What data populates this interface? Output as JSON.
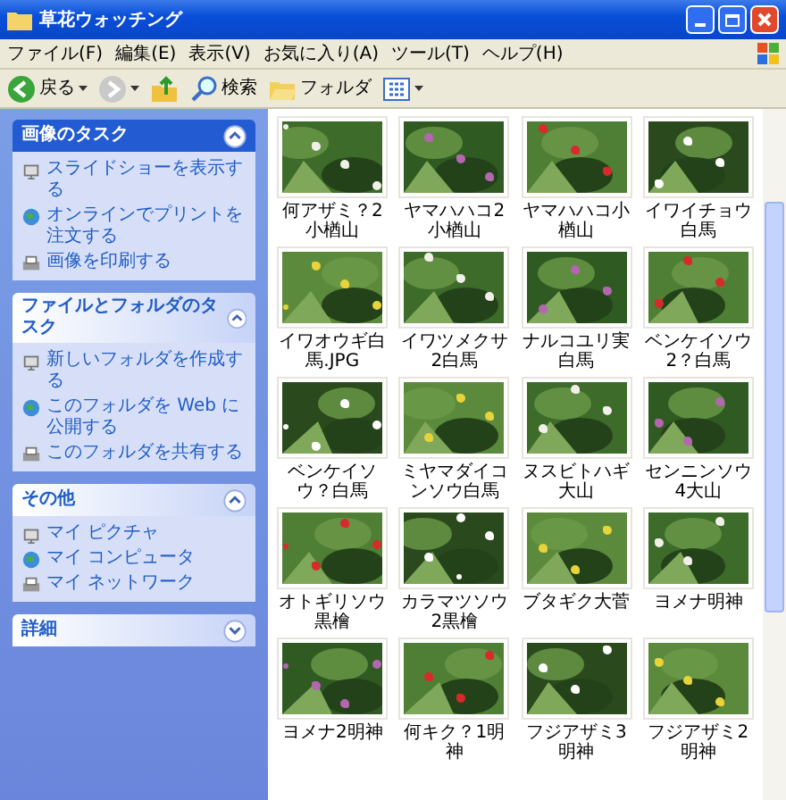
{
  "window": {
    "title": "草花ウォッチング"
  },
  "menu": [
    "ファイル(F)",
    "編集(E)",
    "表示(V)",
    "お気に入り(A)",
    "ツール(T)",
    "ヘルプ(H)"
  ],
  "toolbar": [
    {
      "kind": "back",
      "label": "戻る"
    },
    {
      "kind": "forward"
    },
    {
      "kind": "up"
    },
    {
      "kind": "search",
      "label": "検索"
    },
    {
      "kind": "folders",
      "label": "フォルダ"
    },
    {
      "kind": "views"
    }
  ],
  "sidebar": [
    {
      "title": "画像のタスク",
      "expanded": true,
      "items": [
        "スライドショーを表示する",
        "オンラインでプリントを注文する",
        "画像を印刷する"
      ]
    },
    {
      "title": "ファイルとフォルダのタスク",
      "expanded": true,
      "items": [
        "新しいフォルダを作成する",
        "このフォルダを Web に公開する",
        "このフォルダを共有する"
      ]
    },
    {
      "title": "その他",
      "expanded": true,
      "items": [
        "マイ ピクチャ",
        "マイ コンピュータ",
        "マイ ネットワーク"
      ]
    },
    {
      "title": "詳細",
      "expanded": false
    }
  ],
  "files": [
    {
      "label": "何アザミ？2小楢山"
    },
    {
      "label": "ヤマハハコ2小楢山"
    },
    {
      "label": "ヤマハハコ小楢山"
    },
    {
      "label": "イワイチョウ白馬"
    },
    {
      "label": "イワオウギ白馬.JPG"
    },
    {
      "label": "イワツメクサ2白馬"
    },
    {
      "label": "ナルコユリ実白馬"
    },
    {
      "label": "ベンケイソウ2？白馬"
    },
    {
      "label": "ベンケイソウ？白馬"
    },
    {
      "label": "ミヤマダイコンソウ白馬"
    },
    {
      "label": "ヌスビトハギ大山"
    },
    {
      "label": "センニンソウ4大山"
    },
    {
      "label": "オトギリソウ黒檜"
    },
    {
      "label": "カラマツソウ2黒檜"
    },
    {
      "label": "ブタギク大菅"
    },
    {
      "label": "ヨメナ明神"
    },
    {
      "label": "ヨメナ2明神"
    },
    {
      "label": "何キク？1明神"
    },
    {
      "label": "フジアザミ3明神"
    },
    {
      "label": "フジアザミ2明神"
    }
  ]
}
